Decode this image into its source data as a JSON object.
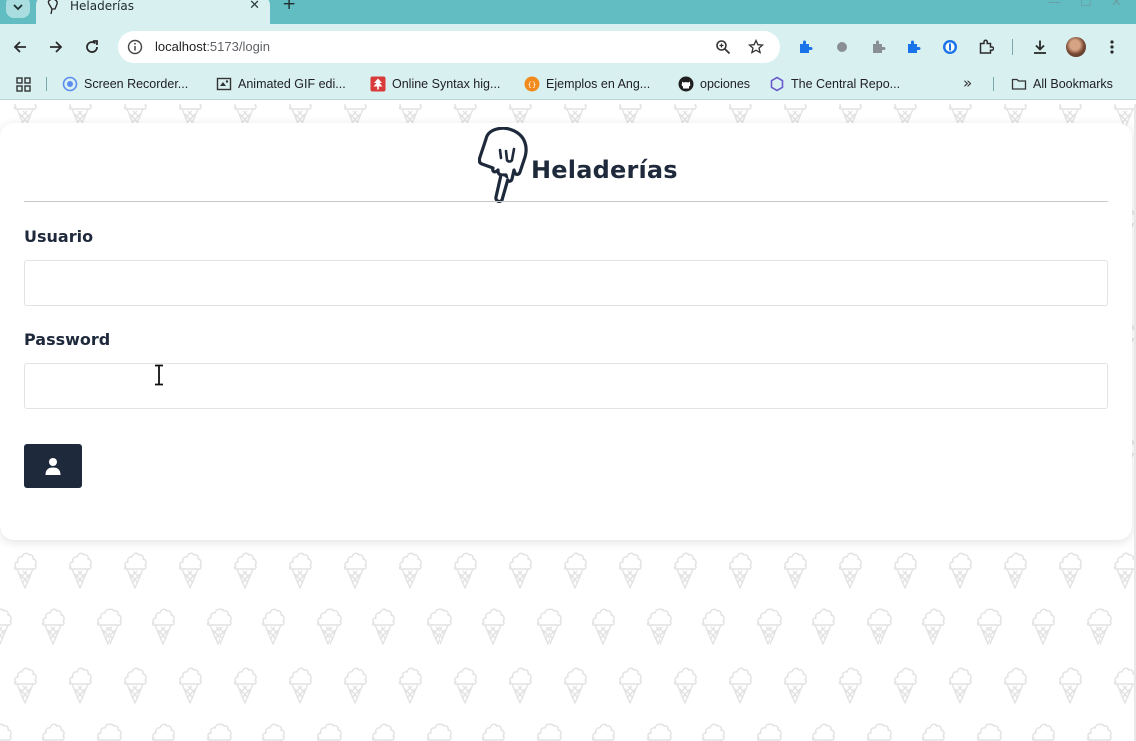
{
  "browser": {
    "tab": {
      "title": "Heladerías"
    },
    "address": {
      "host": "localhost",
      "path": ":5173/login"
    },
    "bookmarks": [
      {
        "label": "Screen Recorder..."
      },
      {
        "label": "Animated GIF edi..."
      },
      {
        "label": "Online Syntax hig..."
      },
      {
        "label": "Ejemplos en Ang..."
      },
      {
        "label": "opciones"
      },
      {
        "label": "The Central Repo..."
      }
    ],
    "all_bookmarks": "All Bookmarks",
    "colors": {
      "frame": "#62bdc3",
      "toolbar": "#d9f0f1"
    }
  },
  "page": {
    "brand": "Heladerías",
    "form": {
      "user_label": "Usuario",
      "user_value": "",
      "password_label": "Password",
      "password_value": ""
    },
    "submit_icon": "user-icon",
    "colors": {
      "primary": "#1e293b",
      "pattern": "#e4e4e4"
    }
  }
}
